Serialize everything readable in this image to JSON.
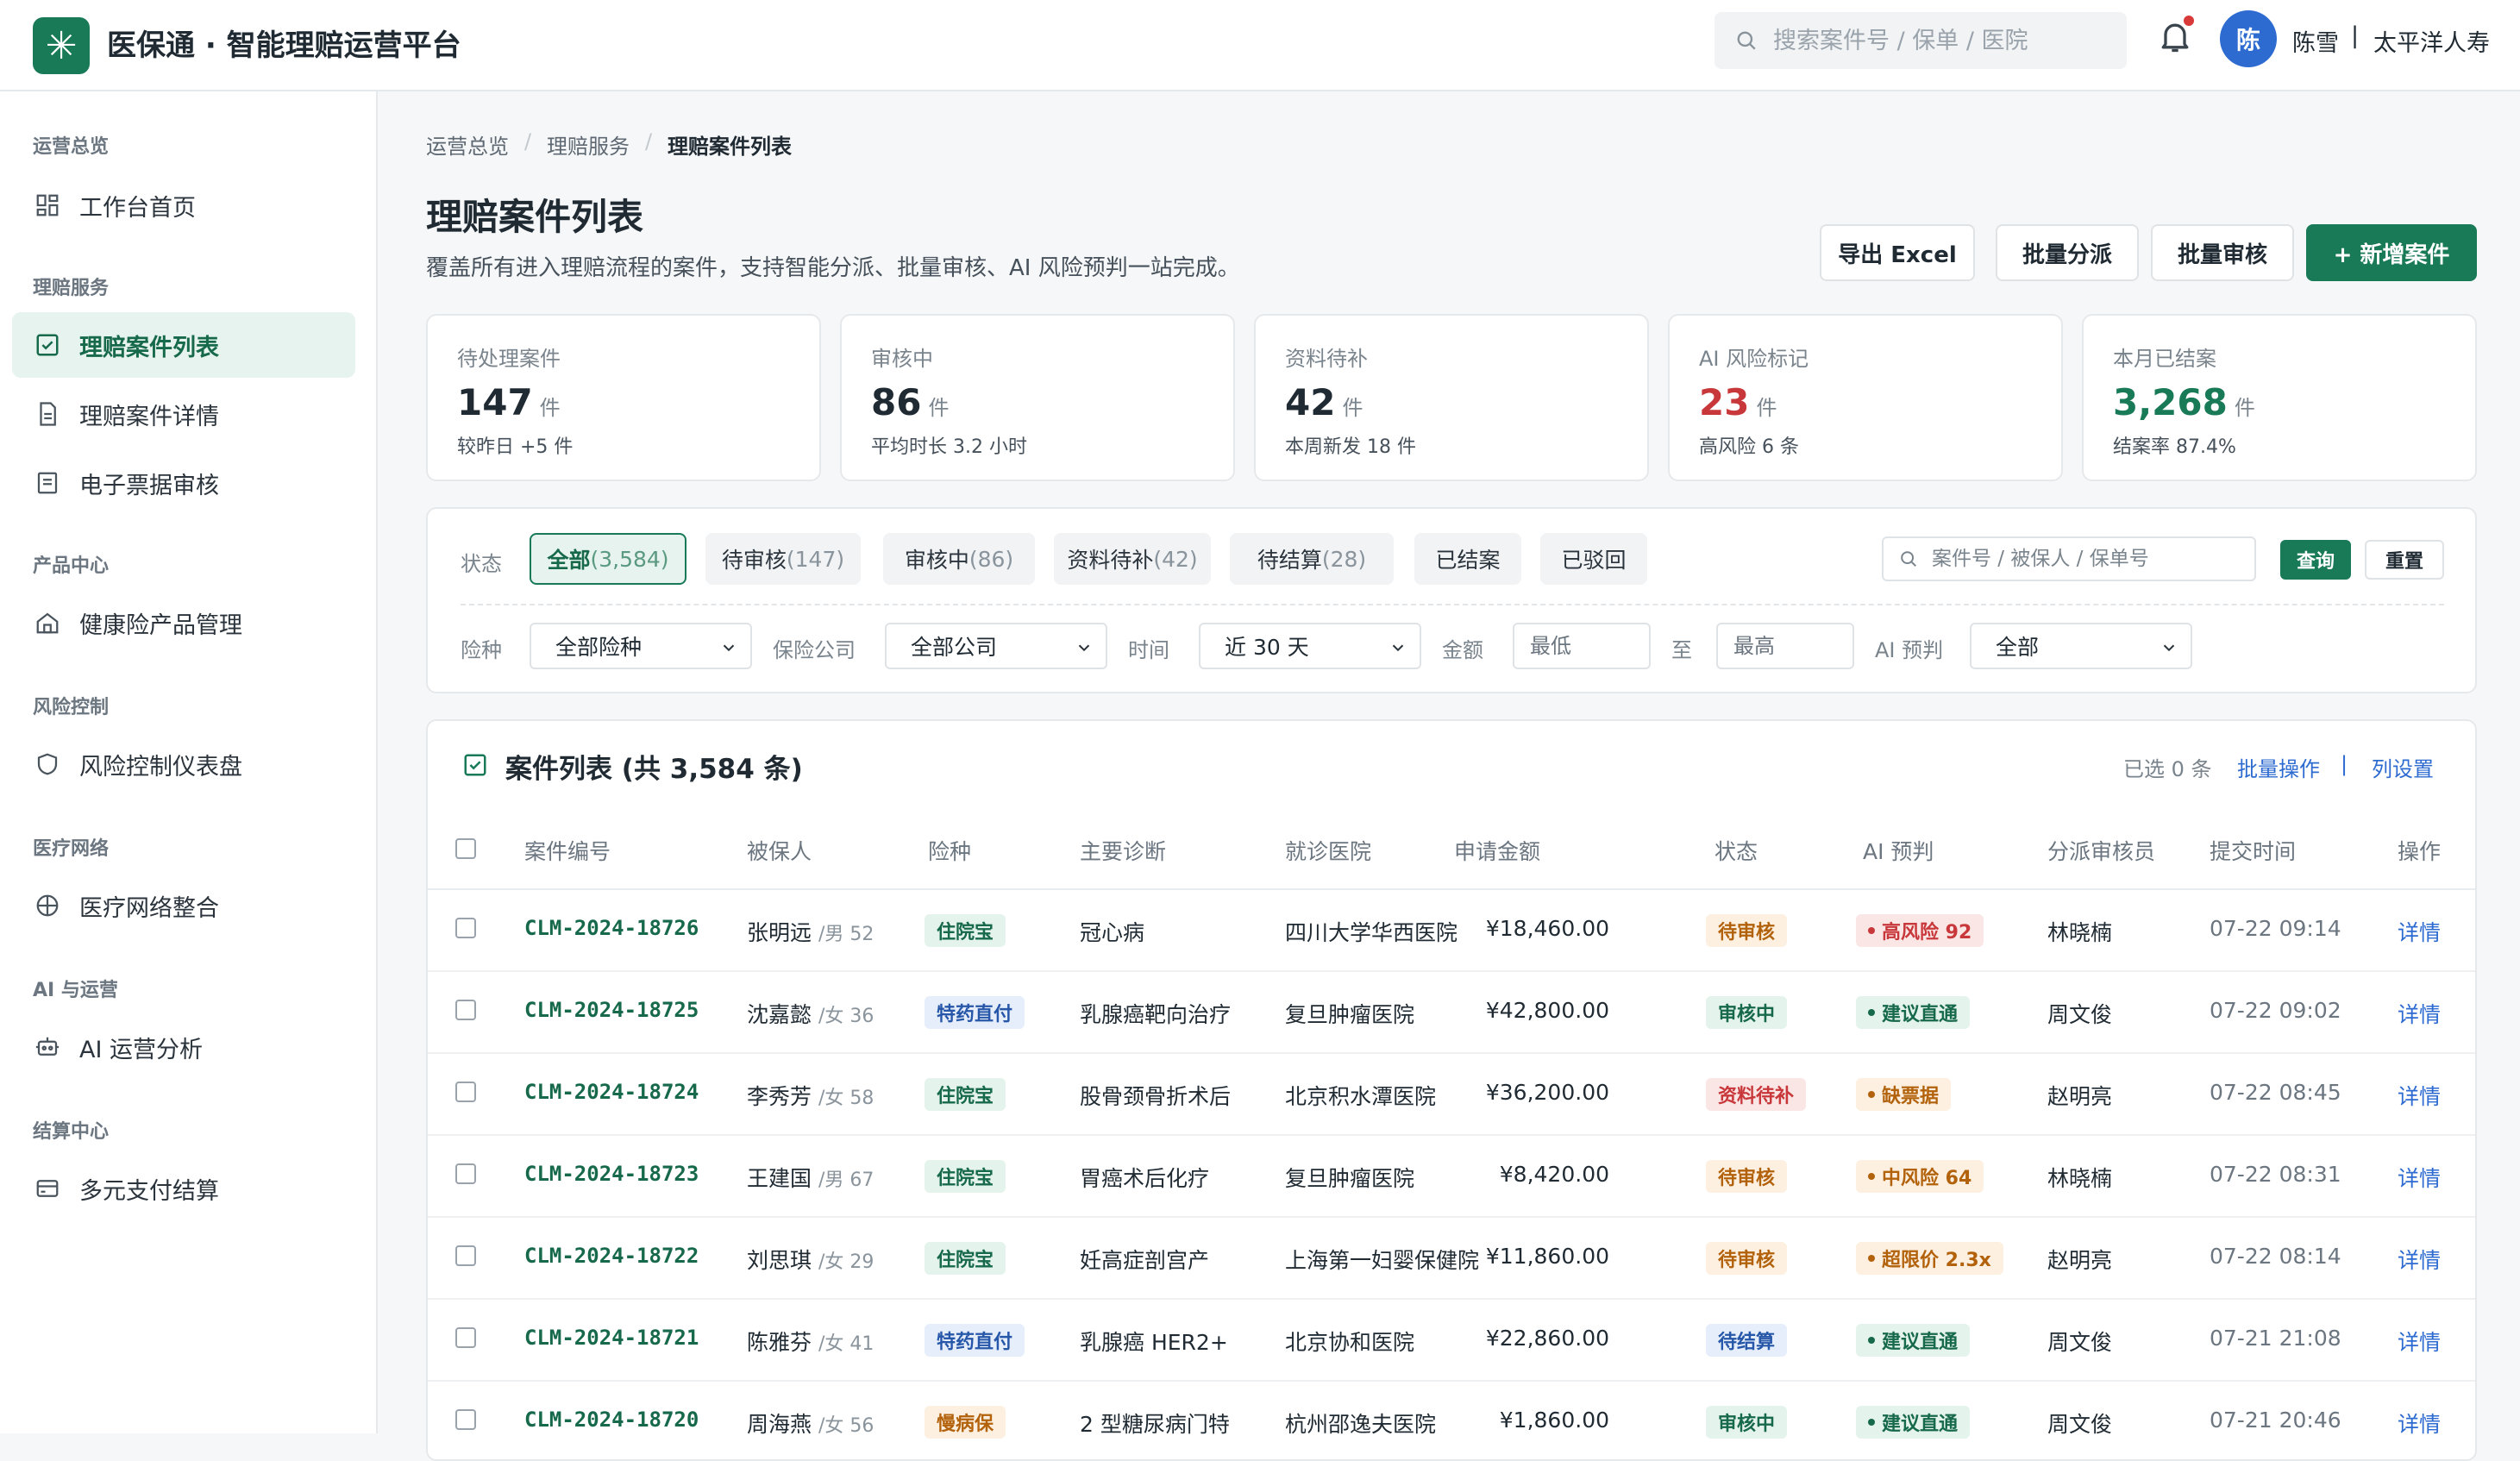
{
  "app": {
    "logo_glyph": "✳",
    "title": "医保通 · 智能理赔运营平台"
  },
  "header": {
    "search_placeholder": "搜索案件号 / 保单 / 医院",
    "avatar_initial": "陈",
    "user_name": "陈雪",
    "separator": "|",
    "org": "太平洋人寿",
    "has_notification": true
  },
  "sidebar": {
    "groups": [
      {
        "title": "运营总览",
        "items": [
          {
            "label": "工作台首页",
            "icon": "dashboard-icon"
          }
        ]
      },
      {
        "title": "理赔服务",
        "items": [
          {
            "label": "理赔案件列表",
            "icon": "checkbox-list-icon",
            "active": true
          },
          {
            "label": "理赔案件详情",
            "icon": "document-icon"
          },
          {
            "label": "电子票据审核",
            "icon": "receipt-icon"
          }
        ]
      },
      {
        "title": "产品中心",
        "items": [
          {
            "label": "健康险产品管理",
            "icon": "home-icon"
          }
        ]
      },
      {
        "title": "风险控制",
        "items": [
          {
            "label": "风险控制仪表盘",
            "icon": "shield-icon"
          }
        ]
      },
      {
        "title": "医疗网络",
        "items": [
          {
            "label": "医疗网络整合",
            "icon": "network-icon"
          }
        ]
      },
      {
        "title": "AI 与运营",
        "items": [
          {
            "label": "AI 运营分析",
            "icon": "robot-icon"
          }
        ]
      },
      {
        "title": "结算中心",
        "items": [
          {
            "label": "多元支付结算",
            "icon": "card-icon"
          }
        ]
      }
    ]
  },
  "breadcrumb": [
    "运营总览",
    "理赔服务",
    "理赔案件列表"
  ],
  "breadcrumb_sep": "/",
  "page": {
    "title": "理赔案件列表",
    "subtitle": "覆盖所有进入理赔流程的案件，支持智能分派、批量审核、AI 风险预判一站完成。"
  },
  "actions": {
    "export": "导出 Excel",
    "batch_assign": "批量分派",
    "batch_review": "批量审核",
    "new_case": "+ 新增案件"
  },
  "stats": [
    {
      "label": "待处理案件",
      "value": "147",
      "unit": "件",
      "sub": "较昨日 +5 件",
      "color": "#1f2a33"
    },
    {
      "label": "审核中",
      "value": "86",
      "unit": "件",
      "sub": "平均时长 3.2 小时",
      "color": "#1f2a33"
    },
    {
      "label": "资料待补",
      "value": "42",
      "unit": "件",
      "sub": "本周新发 18 件",
      "color": "#1f2a33"
    },
    {
      "label": "AI 风险标记",
      "value": "23",
      "unit": "件",
      "sub": "高风险 6 条",
      "color": "#c8383a"
    },
    {
      "label": "本月已结案",
      "value": "3,268",
      "unit": "件",
      "sub": "结案率 87.4%",
      "color": "#197a58"
    }
  ],
  "filters": {
    "status_label": "状态",
    "status_chips": [
      {
        "label": "全部",
        "count": "(3,584)",
        "active": true
      },
      {
        "label": "待审核",
        "count": "(147)"
      },
      {
        "label": "审核中",
        "count": "(86)"
      },
      {
        "label": "资料待补",
        "count": "(42)"
      },
      {
        "label": "待结算",
        "count": "(28)"
      },
      {
        "label": "已结案",
        "count": ""
      },
      {
        "label": "已驳回",
        "count": ""
      }
    ],
    "search_placeholder": "案件号 / 被保人 / 保单号",
    "query_button": "查询",
    "reset_button": "重置",
    "insurance_label": "险种",
    "insurance_value": "全部险种",
    "company_label": "保险公司",
    "company_value": "全部公司",
    "time_label": "时间",
    "time_value": "近 30 天",
    "amount_label": "金额",
    "amount_min_placeholder": "最低",
    "amount_to": "至",
    "amount_max_placeholder": "最高",
    "ai_label": "AI 预判",
    "ai_value": "全部"
  },
  "table": {
    "title": "案件列表 (共 3,584 条)",
    "selected": "已选 0 条",
    "batch_ops": "批量操作",
    "sep": "|",
    "column_settings": "列设置",
    "columns": [
      "案件编号",
      "被保人",
      "险种",
      "主要诊断",
      "就诊医院",
      "申请金额",
      "状态",
      "AI 预判",
      "分派审核员",
      "提交时间",
      "操作"
    ],
    "rows": [
      {
        "id": "CLM-2024-18726",
        "name": "张明远",
        "meta": "/男 52",
        "product": "住院宝",
        "diagnosis": "冠心病",
        "hospital": "四川大学华西医院",
        "amount": "¥18,460.00",
        "status": "待审核",
        "ai": "高风险 92",
        "reviewer": "林晓楠",
        "time": "07-22 09:14",
        "action": "详情"
      },
      {
        "id": "CLM-2024-18725",
        "name": "沈嘉懿",
        "meta": "/女 36",
        "product": "特药直付",
        "diagnosis": "乳腺癌靶向治疗",
        "hospital": "复旦肿瘤医院",
        "amount": "¥42,800.00",
        "status": "审核中",
        "ai": "建议直通",
        "reviewer": "周文俊",
        "time": "07-22 09:02",
        "action": "详情"
      },
      {
        "id": "CLM-2024-18724",
        "name": "李秀芳",
        "meta": "/女 58",
        "product": "住院宝",
        "diagnosis": "股骨颈骨折术后",
        "hospital": "北京积水潭医院",
        "amount": "¥36,200.00",
        "status": "资料待补",
        "ai": "缺票据",
        "reviewer": "赵明亮",
        "time": "07-22 08:45",
        "action": "详情"
      },
      {
        "id": "CLM-2024-18723",
        "name": "王建国",
        "meta": "/男 67",
        "product": "住院宝",
        "diagnosis": "胃癌术后化疗",
        "hospital": "复旦肿瘤医院",
        "amount": "¥8,420.00",
        "status": "待审核",
        "ai": "中风险 64",
        "reviewer": "林晓楠",
        "time": "07-22 08:31",
        "action": "详情"
      },
      {
        "id": "CLM-2024-18722",
        "name": "刘思琪",
        "meta": "/女 29",
        "product": "住院宝",
        "diagnosis": "妊高症剖宫产",
        "hospital": "上海第一妇婴保健院",
        "amount": "¥11,860.00",
        "status": "待审核",
        "ai": "超限价 2.3x",
        "reviewer": "赵明亮",
        "time": "07-22 08:14",
        "action": "详情"
      },
      {
        "id": "CLM-2024-18721",
        "name": "陈雅芬",
        "meta": "/女 41",
        "product": "特药直付",
        "diagnosis": "乳腺癌 HER2+",
        "hospital": "北京协和医院",
        "amount": "¥22,860.00",
        "status": "待结算",
        "ai": "建议直通",
        "reviewer": "周文俊",
        "time": "07-21 21:08",
        "action": "详情"
      },
      {
        "id": "CLM-2024-18720",
        "name": "周海燕",
        "meta": "/女 56",
        "product": "慢病保",
        "diagnosis": "2 型糖尿病门特",
        "hospital": "杭州邵逸夫医院",
        "amount": "¥1,860.00",
        "status": "审核中",
        "ai": "建议直通",
        "reviewer": "周文俊",
        "time": "07-21 20:46",
        "action": "详情"
      }
    ]
  },
  "colors": {
    "brand": "#197a58",
    "tag_green_bg": "#e4f3ec",
    "tag_green_fg": "#17694c",
    "tag_blue_bg": "#e6eefb",
    "tag_blue_fg": "#2757a8",
    "tag_orange_bg": "#fdf0e1",
    "tag_orange_fg": "#b3620c",
    "tag_red_bg": "#fbe6e6",
    "tag_red_fg": "#c8383a"
  }
}
